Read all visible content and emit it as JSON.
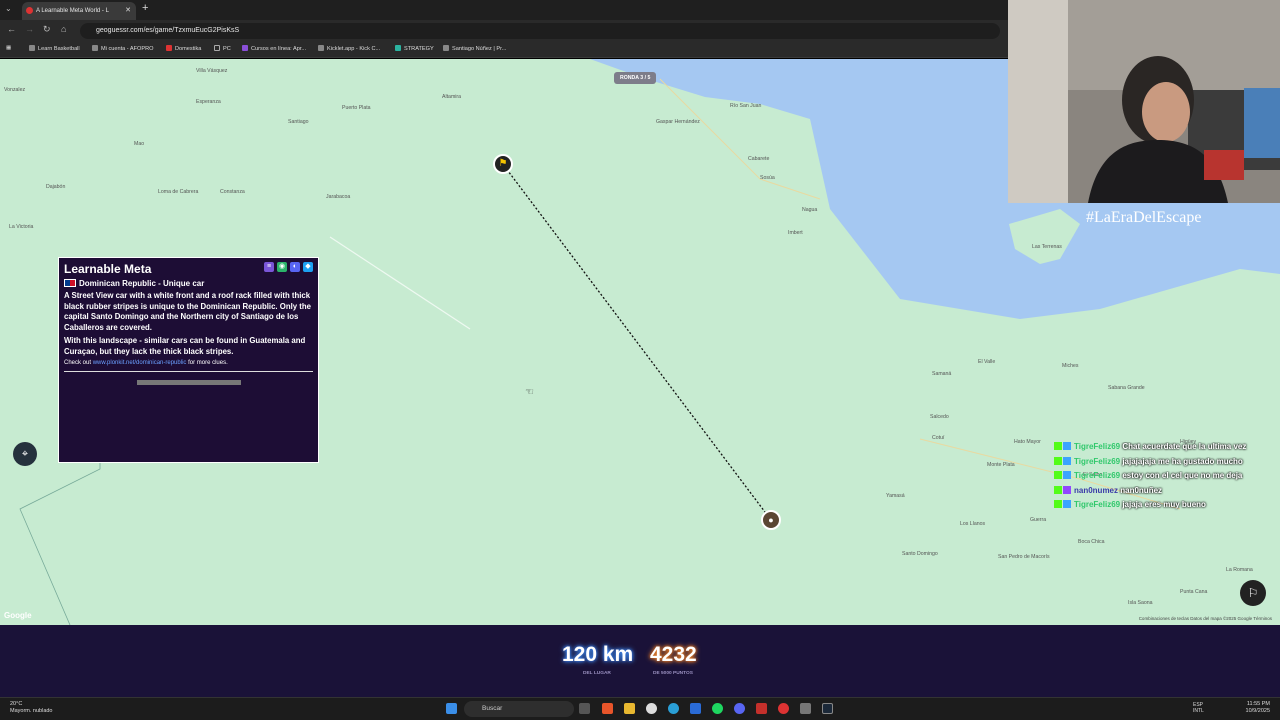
{
  "browser": {
    "tab_title": "A Learnable Meta World - L",
    "url": "geoguessr.com/es/game/TzxmuEucG2PisKsS",
    "bookmarks": [
      "Learn Basketball",
      "Mi cuenta - AFOPRO",
      "Domestika",
      "PC",
      "Cursos en línea: Apr...",
      "Kicklet.app - Kick C...",
      "STRATEGY",
      "Santiago Núñez | Pr..."
    ]
  },
  "map": {
    "round": "RONDA 3 / 5",
    "labels": {
      "vonzalez": "Vonzalez",
      "cabarete": "Cabarete",
      "sosua": "Sosúa",
      "imbert": "Imbert",
      "nagua": "Nagua",
      "samana": "Samaná",
      "las_terrenas": "Las Terrenas",
      "santiago": "Santiago",
      "moca": "Moca",
      "salcedo": "Salcedo",
      "san_francisco": "San Francisco de Macorís",
      "la_vega": "La Vega",
      "cotui": "Cotuí",
      "bonao": "Bonao",
      "monte_plata": "Monte Plata",
      "hato_mayor": "Hato Mayor",
      "el_seibo": "El Seibo",
      "higuey": "Higüey",
      "santo_domingo": "Santo Domingo",
      "san_pedro": "San Pedro de Macorís",
      "la_romana": "La Romana",
      "punta_cana": "Punta Cana",
      "isla_saona": "Isla Saona",
      "boca_chica": "Boca Chica",
      "guerra": "Guerra",
      "yamasa": "Yamasá",
      "los_llanos": "Los Llanos",
      "el_valle": "El Valle",
      "sabana_grande": "Sabana Grande",
      "miches": "Miches",
      "rio_san_juan": "Río San Juan",
      "gaspar": "Gaspar Hernández",
      "villa_vasquez": "Villa Vásquez",
      "mao": "Mao",
      "esperanza": "Esperanza",
      "dajabon": "Dajabón",
      "loma_cabrera": "Loma de Cabrera",
      "puerto_plata": "Puerto Plata",
      "altamira": "Altamira",
      "jarabacoa": "Jarabacoa",
      "constanza": "Constanza",
      "la_victoria": "La Victoria"
    },
    "attribution": "Combinaciones de teclas   Datos del mapa ©2025 Google   Términos",
    "google": "Google"
  },
  "meta_panel": {
    "title": "Learnable Meta",
    "subtitle": "Dominican Republic - Unique car",
    "p1": "A Street View car with a white front and a roof rack filled with thick black rubber stripes is unique to the Dominican Republic. Only the capital Santo Domingo and the Northern city of Santiago de los Caballeros are covered.",
    "p2": "With this landscape - similar cars can be found in Guatemala and Curaçao, but they lack the thick black stripes.",
    "check_prefix": "Check out",
    "link": "www.plonkit.net/dominican-republic",
    "check_suffix": "for more clues."
  },
  "chat": [
    {
      "user": "TigreFeliz69",
      "msg": "Chat acuerdate que la ultima vez"
    },
    {
      "user": "TigreFeliz69",
      "msg": "jajajajaja me ha gustado mucho"
    },
    {
      "user": "TigreFeliz69",
      "msg": "estoy con el cel que no me deja"
    },
    {
      "user": "nan0numez",
      "msg": "nan0nuñez",
      "purple": true
    },
    {
      "user": "TigreFeliz69",
      "msg": "jajaja eres muy bueno"
    }
  ],
  "stream": {
    "hashtag": "#LaEraDelEscape"
  },
  "score": {
    "distance": "120 km",
    "distance_sub": "DEL LUGAR",
    "points": "4232",
    "points_sub": "DE 5000 PUNTOS"
  },
  "taskbar": {
    "weather_temp": "20°C",
    "weather_desc": "Mayorm. nublado",
    "search": "Buscar",
    "lang1": "ESP",
    "lang2": "INTL",
    "time": "11:55 PM",
    "date": "10/9/2025"
  },
  "colors": {
    "land": "#c7ebd1",
    "water": "#a5c8f2",
    "panel": "#1d0d35",
    "chat_user": "#31c86c"
  }
}
